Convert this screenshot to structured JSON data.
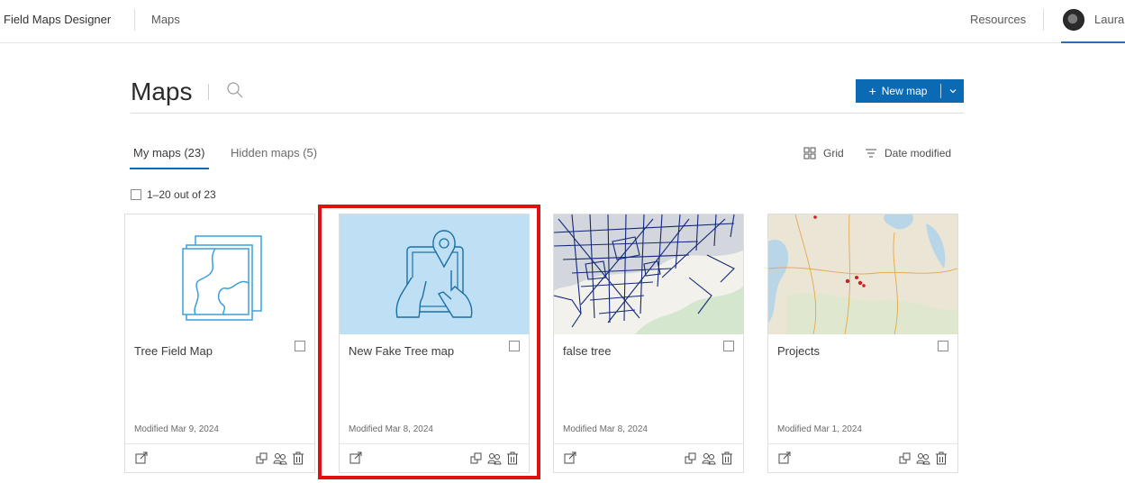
{
  "topbar": {
    "app_title": "Field Maps Designer",
    "nav_maps": "Maps",
    "resources": "Resources",
    "username": "Laura"
  },
  "header": {
    "title": "Maps",
    "new_map_label": "New map"
  },
  "tabs": [
    {
      "label": "My maps (23)",
      "active": true
    },
    {
      "label": "Hidden maps (5)",
      "active": false
    }
  ],
  "view": {
    "grid_label": "Grid",
    "sort_label": "Date modified"
  },
  "selection": {
    "range_label": "1–20 out of 23"
  },
  "cards": [
    {
      "title": "Tree Field Map",
      "modified": "Modified Mar 9, 2024",
      "thumb": "map-layers-icon"
    },
    {
      "title": "New Fake Tree map",
      "modified": "Modified Mar 8, 2024",
      "thumb": "tablet-location-icon"
    },
    {
      "title": "false tree",
      "modified": "Modified Mar 8, 2024",
      "thumb": "street-network-map"
    },
    {
      "title": "Projects",
      "modified": "Modified Mar 1, 2024",
      "thumb": "basemap-with-points"
    }
  ],
  "colors": {
    "accent": "#0b6ab4",
    "highlight": "#e01010",
    "thumb_blue": "#bfe0f4",
    "icon_line": "#1a6fa8"
  }
}
